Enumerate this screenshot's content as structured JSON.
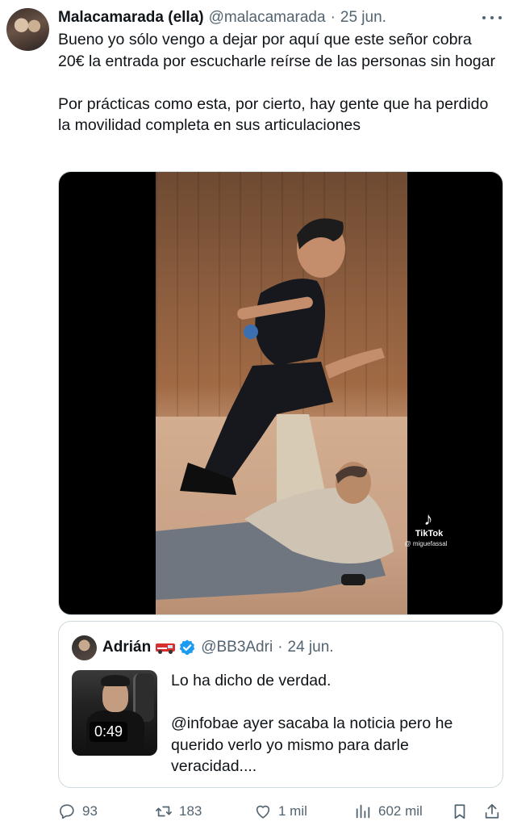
{
  "tweet": {
    "author_name": "Malacamarada (ella)",
    "handle": "@malacamarada",
    "separator": "·",
    "date": "25 jun.",
    "text": "Bueno yo sólo vengo a dejar por aquí que este señor cobra 20€ la entrada por escucharle reírse de las personas sin hogar\n\nPor prácticas como esta, por cierto, hay gente que ha perdido la movilidad completa en sus articulaciones",
    "media": {
      "watermark_brand": "TikTok",
      "watermark_user": "@ miguefassal"
    }
  },
  "quoted": {
    "author_name": "Adrián",
    "badge_emoji": "ambulance-emoji",
    "verified": true,
    "handle": "@BB3Adri",
    "separator": "·",
    "date": "24 jun.",
    "video_duration": "0:49",
    "text": "Lo ha dicho de verdad.\n\n@infobae ayer sacaba la noticia pero he querido verlo yo mismo para darle veracidad...."
  },
  "actions": {
    "replies": "93",
    "reposts": "183",
    "likes": "1 mil",
    "views": "602 mil"
  },
  "colors": {
    "text": "#0f1419",
    "muted": "#536471",
    "border": "#cfd9de",
    "verified": "#1d9bf0"
  }
}
